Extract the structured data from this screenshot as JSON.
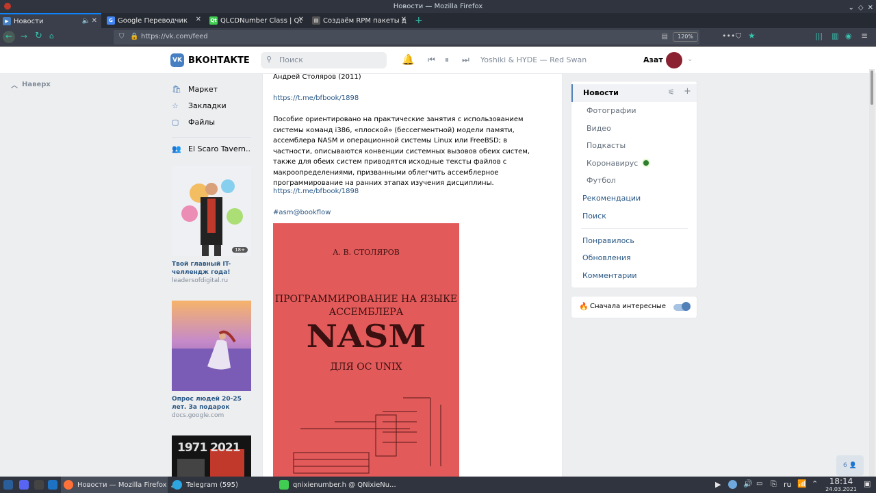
{
  "window": {
    "title": "Новости — Mozilla Firefox"
  },
  "tabs": [
    {
      "label": "Новости",
      "active": true
    },
    {
      "label": "Google Переводчик",
      "active": false
    },
    {
      "label": "QLCDNumber Class | Qt",
      "active": false
    },
    {
      "label": "Создаём RPM пакеты д",
      "active": false
    }
  ],
  "navbar": {
    "url": "https://vk.com/feed",
    "zoom": "120%"
  },
  "vk": {
    "logo": "ВКОНТАКТЕ",
    "search_placeholder": "Поиск",
    "track": "Yoshiki & HYDE — Red Swan",
    "user": "Азат"
  },
  "left": {
    "up": "Наверх",
    "menu": [
      {
        "label": "Маркет"
      },
      {
        "label": "Закладки"
      },
      {
        "label": "Файлы"
      },
      {
        "label": "El Scaro Tavern.."
      }
    ],
    "ads": [
      {
        "title": "Твой главный IT-челлендж года!",
        "domain": "leadersofdigital.ru",
        "badge": "18+"
      },
      {
        "title": "Опрос людей 20-25 лет. За подарок",
        "domain": "docs.google.com"
      },
      {
        "title": "",
        "domain": "",
        "years": "1971 2021"
      }
    ]
  },
  "post": {
    "author_line": "Андрей Столяров (2011)",
    "link1": "https://t.me/bfbook/1898",
    "body": "Пособие ориентировано на практические занятия с использованием системы команд i386, «плоской» (бессегментной) модели памяти, ассемблера NASM и операционной системы Linux или FreeBSD; в частности, описываются конвенции системных вызовов обеих систем, также для обеих систем приводятся исходные тексты файлов с макроопределениями, призванными облегчить ассемблерное программирование на ранних этапах изучения дисциплины.",
    "link2": "https://t.me/bfbook/1898",
    "tag": "#asm@bookflow",
    "book": {
      "author": "А. В. СТОЛЯРОВ",
      "title1": "ПРОГРАММИРОВАНИЕ НА ЯЗЫКЕ АССЕМБЛЕРА",
      "title2": "NASM",
      "title3": "ДЛЯ ОС UNIX"
    }
  },
  "right": {
    "items": [
      {
        "label": "Новости"
      },
      {
        "label": "Фотографии"
      },
      {
        "label": "Видео"
      },
      {
        "label": "Подкасты"
      },
      {
        "label": "Коронавирус"
      },
      {
        "label": "Футбол"
      },
      {
        "label": "Рекомендации"
      },
      {
        "label": "Поиск"
      },
      {
        "label": "Понравилось"
      },
      {
        "label": "Обновления"
      },
      {
        "label": "Комментарии"
      }
    ],
    "toggle_label": "Сначала интересные"
  },
  "online_count": "6",
  "taskbar": {
    "items": [
      {
        "label": "Новости — Mozilla Firefox"
      },
      {
        "label": "Telegram (595)"
      },
      {
        "label": "qnixienumber.h @ QNixieNu..."
      }
    ],
    "lang": "ru",
    "time": "18:14",
    "date": "24.03.2021"
  },
  "colors": {
    "vk_blue": "#4680c2",
    "link": "#2a5885",
    "book_red": "#e25a5a",
    "firefox_accent": "#0a84ff"
  }
}
